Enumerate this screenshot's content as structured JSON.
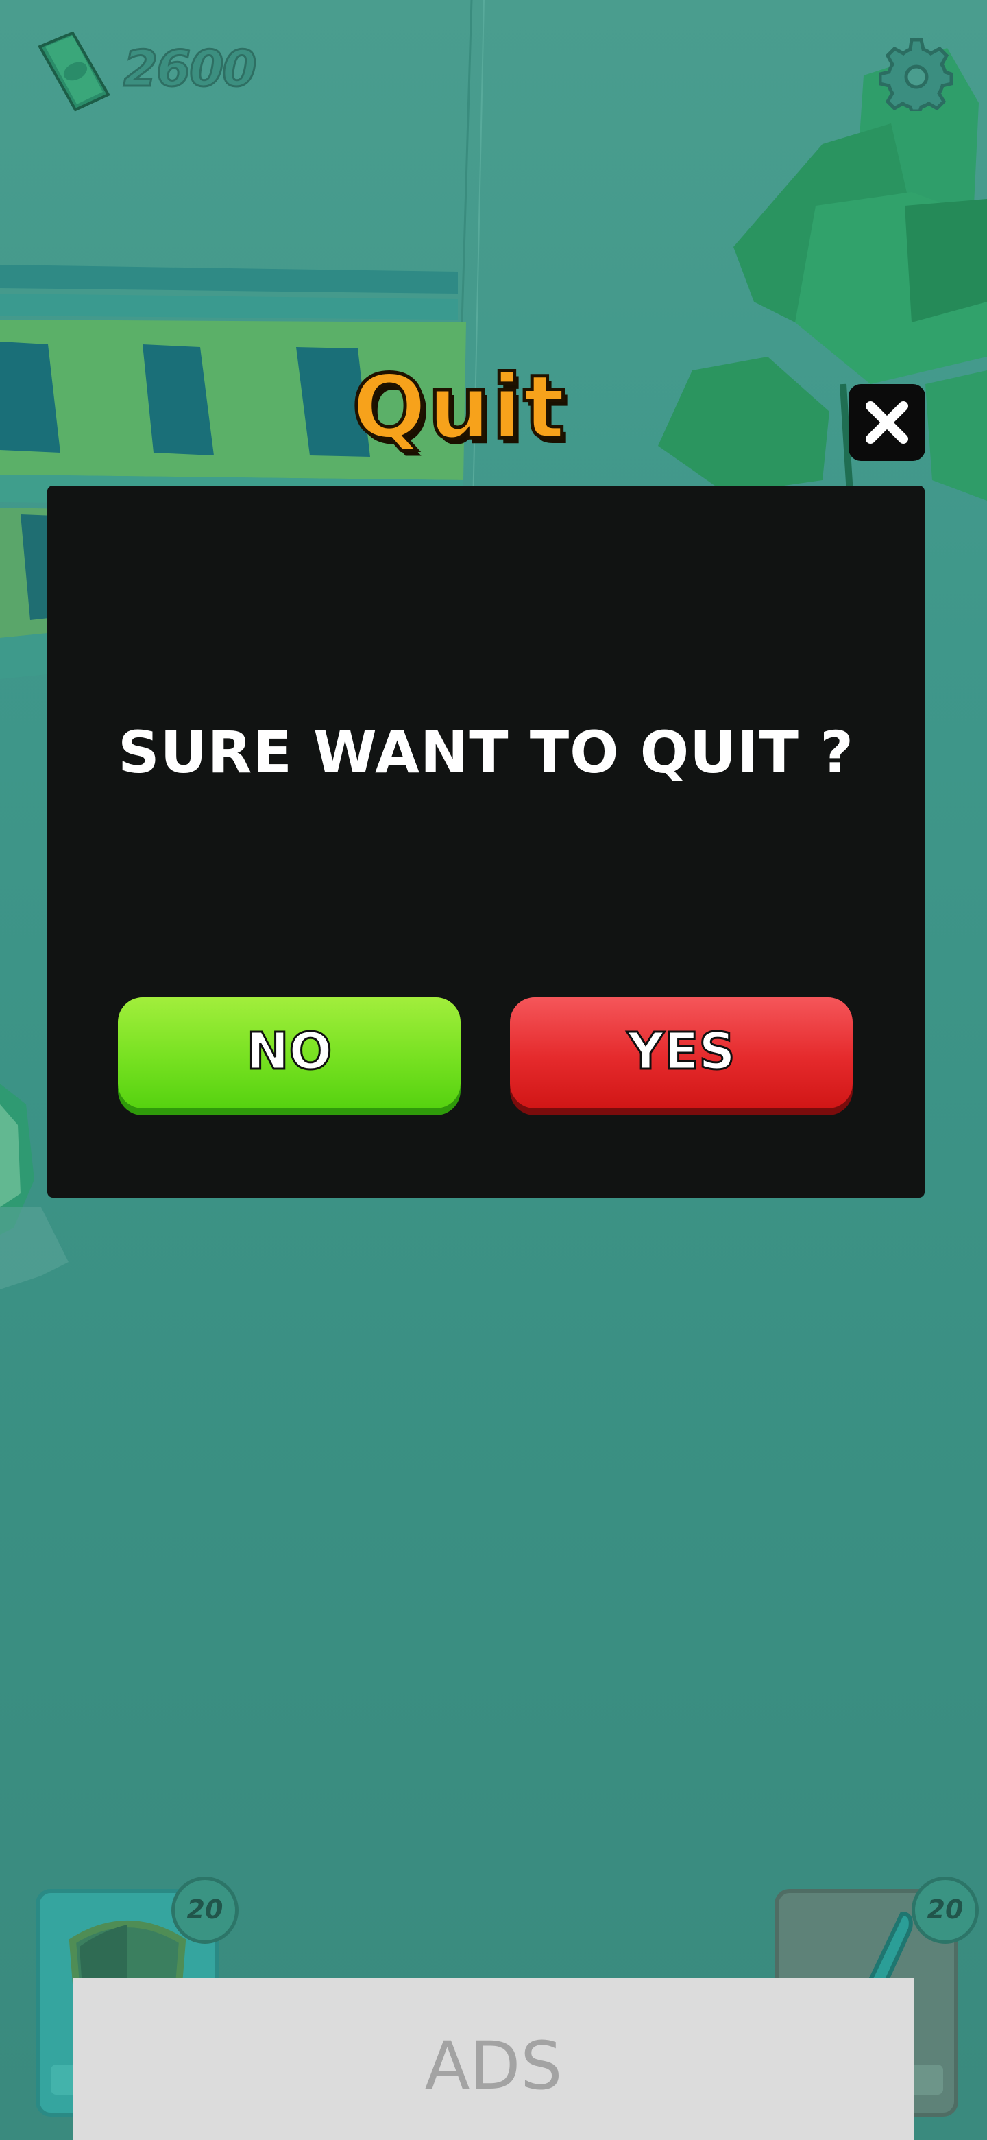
{
  "hud": {
    "cash": "2600",
    "cash_icon": "cash-bill-icon",
    "settings_icon": "gear-icon"
  },
  "dialog": {
    "title": "Quit",
    "message": "SURE WANT TO QUIT ?",
    "no_label": "NO",
    "yes_label": "YES",
    "close_icon": "close-icon"
  },
  "powerups": [
    {
      "icon": "shield-icon",
      "count": "20"
    },
    {
      "icon": "sword-icon",
      "count": "20"
    }
  ],
  "ads": {
    "label": "ADS"
  },
  "colors": {
    "background": "#3f978a",
    "title": "#f7a21b",
    "dialog_bg": "#111312",
    "no_button": "#77e121",
    "yes_button": "#e52a2c"
  }
}
